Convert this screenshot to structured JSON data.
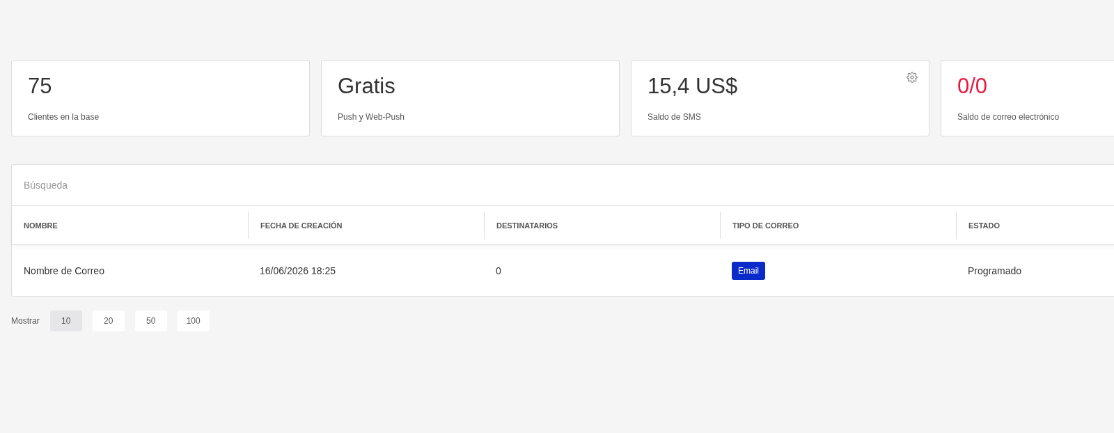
{
  "cards": [
    {
      "value": "75",
      "label": "Clientes en la base",
      "alert": false,
      "settings": false
    },
    {
      "value": "Gratis",
      "label": "Push y Web-Push",
      "alert": false,
      "settings": false
    },
    {
      "value": "15,4 US$",
      "label": "Saldo de SMS",
      "alert": false,
      "settings": true
    },
    {
      "value": "0/0",
      "label": "Saldo de correo electrónico",
      "alert": true,
      "settings": false
    }
  ],
  "search": {
    "placeholder": "Búsqueda"
  },
  "table": {
    "columns": [
      "NOMBRE",
      "FECHA DE CREACIÓN",
      "DESTINATARIOS",
      "TIPO DE CORREO",
      "ESTADO"
    ],
    "rows": [
      {
        "cells": [
          {
            "kind": "text",
            "text": "Nombre de Correo"
          },
          {
            "kind": "text",
            "text": "16/06/2026 18:25"
          },
          {
            "kind": "text",
            "text": "0"
          },
          {
            "kind": "tag",
            "text": "Email"
          },
          {
            "kind": "text",
            "text": "Programado"
          }
        ]
      }
    ]
  },
  "pagination": {
    "label": "Mostrar",
    "sizes": [
      {
        "label": "10",
        "selected": true
      },
      {
        "label": "20",
        "selected": false
      },
      {
        "label": "50",
        "selected": false
      },
      {
        "label": "100",
        "selected": false
      }
    ]
  }
}
